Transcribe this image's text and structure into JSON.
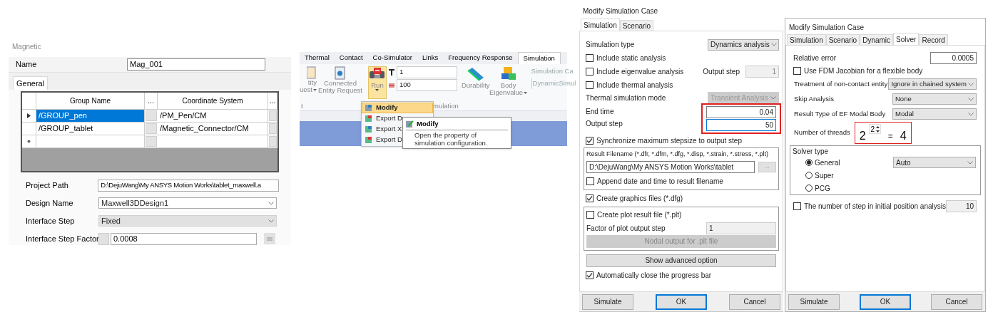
{
  "magnetic": {
    "title": "Magnetic",
    "name_label": "Name",
    "name_value": "Mag_001",
    "tabs": [
      {
        "label": "General",
        "selected": true
      }
    ],
    "columns": [
      "Group Name",
      "...",
      "Coordinate System",
      "..."
    ],
    "rows": [
      {
        "kind": "current",
        "selected": true,
        "group": "/GROUP_pen",
        "coord": "/PM_Pen/CM"
      },
      {
        "kind": "normal",
        "selected": false,
        "group": "/GROUP_tablet",
        "coord": "/Magnetic_Connector/CM"
      },
      {
        "kind": "new",
        "selected": false
      }
    ],
    "fields": [
      {
        "kind": "text",
        "label": "Project Path",
        "value": "D:\\DejuWang\\My ANSYS Motion Works\\tablet_maxwell.a"
      },
      {
        "kind": "dropdown",
        "label": "Design Name",
        "value": "Maxwell3DDesign1",
        "disabled": false
      },
      {
        "kind": "dropdown",
        "label": "Interface Step",
        "value": "Fixed",
        "disabled": true
      },
      {
        "kind": "factor",
        "label": "Interface Step Factor",
        "value": "0.0008"
      }
    ]
  },
  "ribbon": {
    "tabs": [
      {
        "label": "Thermal",
        "selected": false
      },
      {
        "label": "Contact",
        "selected": false
      },
      {
        "label": "Co-Simulator",
        "selected": false
      },
      {
        "label": "Links",
        "selected": false
      },
      {
        "label": "Frequency Response",
        "selected": false
      },
      {
        "label": "Simulation",
        "selected": true
      }
    ],
    "cut_button": [
      "tity",
      "uest"
    ],
    "connected_button": [
      "Connected",
      "Entity Request"
    ],
    "run": {
      "label": "Run",
      "pressed": true
    },
    "end_time": "1",
    "steps": "100",
    "durability": "Durability",
    "eigenvalue": [
      "Body",
      "Eigenvalue"
    ],
    "case_label": "Simulation Ca",
    "case_value": "DynamicSimul",
    "group_labels": [
      "t",
      "mulation"
    ],
    "menu": [
      {
        "label": "Modify",
        "highlighted": true
      },
      {
        "label": "Export D",
        "highlighted": false
      },
      {
        "label": "Export X",
        "highlighted": false
      },
      {
        "label": "Export D",
        "highlighted": false
      }
    ],
    "tooltip": {
      "title": "Modify",
      "text": "Open the property of simulation configuration."
    }
  },
  "dialog1": {
    "title": "Modify Simulation Case",
    "tabs": [
      {
        "label": "Simulation",
        "selected": true
      },
      {
        "label": "Scenario",
        "selected": false
      }
    ],
    "sim_type": {
      "label": "Simulation type",
      "value": "Dynamics analysis"
    },
    "static": {
      "label": "Include static analysis",
      "checked": false
    },
    "eigen": {
      "label": "Include eigenvalue analysis",
      "checked": false,
      "step_label": "Output step",
      "step_value": "1"
    },
    "thermal": {
      "label": "Include thermal analysis",
      "checked": false
    },
    "thermal_mode": {
      "label": "Thermal simulation mode",
      "value": "Transient Analysis",
      "disabled": true
    },
    "end_time": {
      "label": "End time",
      "value": "0.04"
    },
    "output_step": {
      "label": "Output step",
      "value": "50",
      "focused": true
    },
    "sync": {
      "label": "Synchronize maximum stepsize to output step",
      "checked": true
    },
    "result": {
      "title": "Result Filename (*.dfr, *.dfm, *.dfg, *.disp, *.strain, *.stress, *.plt)",
      "path": "D:\\DejuWang\\My ANSYS Motion Works\\tablet",
      "browse": "...",
      "append": {
        "label": "Append date and time to result filename",
        "checked": false
      }
    },
    "graphics": {
      "label": "Create graphics files (*.dfg)",
      "checked": true
    },
    "plot": {
      "label": "Create plot result file (*.plt)",
      "checked": false,
      "factor_label": "Factor of plot output step",
      "factor_value": "1",
      "nodal": "Nodal output for .plt file"
    },
    "advanced": "Show advanced option",
    "autoclose": {
      "label": "Automatically close the progress bar",
      "checked": true
    },
    "buttons": [
      {
        "label": "Simulate",
        "default": false
      },
      {
        "label": "OK",
        "default": true
      },
      {
        "label": "Cancel",
        "default": false
      }
    ]
  },
  "dialog2": {
    "title": "Modify Simulation Case",
    "tabs": [
      {
        "label": "Simulation",
        "selected": false
      },
      {
        "label": "Scenario",
        "selected": false
      },
      {
        "label": "Dynamic",
        "selected": false
      },
      {
        "label": "Solver",
        "selected": true
      },
      {
        "label": "Record",
        "selected": false
      }
    ],
    "rel_error": {
      "label": "Relative error",
      "value": "0.0005"
    },
    "fdm": {
      "label": "Use FDM Jacobian for a flexible body",
      "checked": false
    },
    "selects": [
      {
        "label": "Treatment of non-contact entity",
        "value": "Ignore in chained system"
      },
      {
        "label": "Skip Analysis",
        "value": "None"
      },
      {
        "label": "Result Type of EF Modal Body",
        "value": "Modal"
      }
    ],
    "threads": {
      "label": "Number of threads",
      "value": "2"
    },
    "annotation": {
      "base": "2",
      "equals": "=",
      "result": "4"
    },
    "solver": {
      "title": "Solver type",
      "options": [
        {
          "label": "General",
          "selected": true
        },
        {
          "label": "Super",
          "selected": false
        },
        {
          "label": "PCG",
          "selected": false
        }
      ],
      "mode": "Auto"
    },
    "init_steps": {
      "label": "The number of step in initial position analysis",
      "checked": false,
      "value": "10"
    },
    "buttons": [
      {
        "label": "Simulate",
        "default": false
      },
      {
        "label": "OK",
        "default": true
      },
      {
        "label": "Cancel",
        "default": false
      }
    ]
  }
}
